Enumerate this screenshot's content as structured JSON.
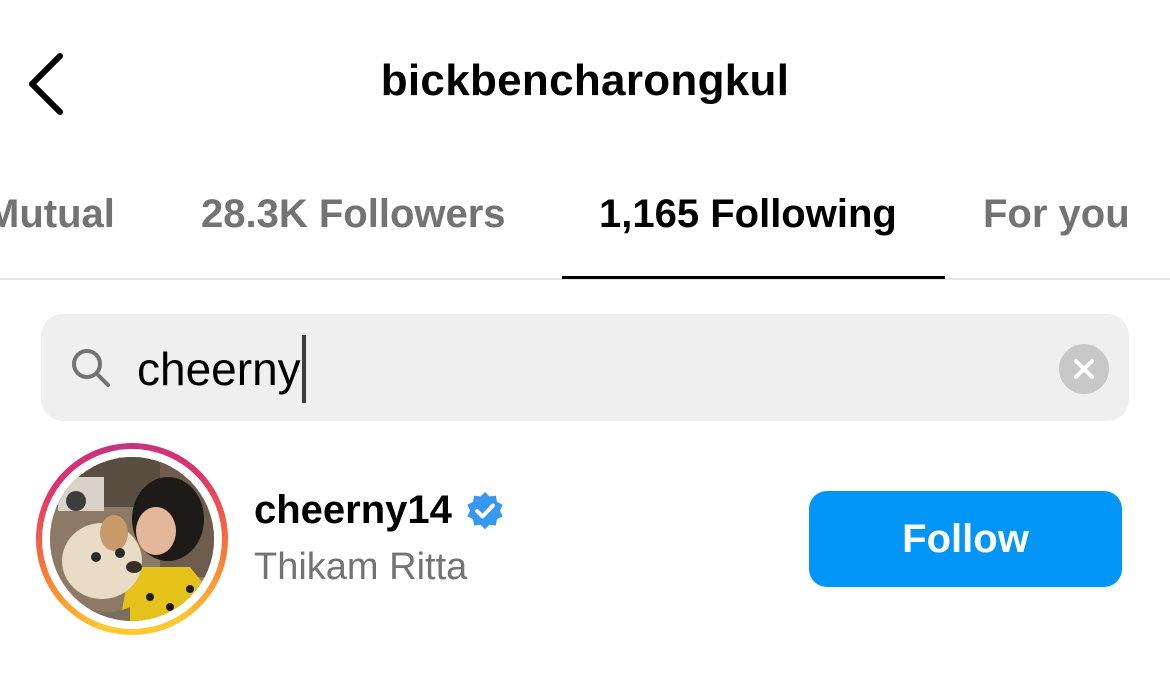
{
  "header": {
    "title": "bickbencharongkul",
    "back_icon": "chevron-left-icon"
  },
  "tabs": [
    {
      "label": "Mutual",
      "active": false
    },
    {
      "label": "28.3K Followers",
      "active": false
    },
    {
      "label": "1,165 Following",
      "active": true
    },
    {
      "label": "For you",
      "active": false
    }
  ],
  "search": {
    "value": "cheerny",
    "icon": "search-icon",
    "clear_icon": "clear-icon"
  },
  "results": [
    {
      "username": "cheerny14",
      "full_name": "Thikam Ritta",
      "verified": true,
      "follow_label": "Follow"
    }
  ],
  "colors": {
    "accent": "#0095f6",
    "verified": "#3897f0",
    "secondary_text": "#737373",
    "search_bg": "#efefef"
  }
}
